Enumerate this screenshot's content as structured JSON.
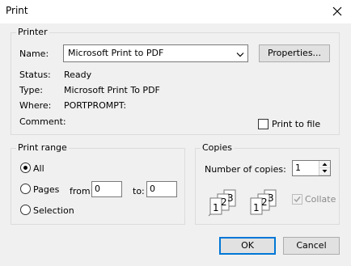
{
  "window": {
    "title": "Print"
  },
  "printer": {
    "group_label": "Printer",
    "name_label": "Name:",
    "name_value": "Microsoft Print to PDF",
    "properties_button": "Properties...",
    "status_label": "Status:",
    "status_value": "Ready",
    "type_label": "Type:",
    "type_value": "Microsoft Print To PDF",
    "where_label": "Where:",
    "where_value": "PORTPROMPT:",
    "comment_label": "Comment:",
    "print_to_file_label": "Print to file",
    "print_to_file_checked": false
  },
  "print_range": {
    "group_label": "Print range",
    "all_label": "All",
    "pages_label": "Pages",
    "from_label": "from:",
    "from_value": "0",
    "to_label": "to:",
    "to_value": "0",
    "selection_label": "Selection",
    "selected": "All"
  },
  "copies": {
    "group_label": "Copies",
    "number_label": "Number of copies:",
    "number_value": "1",
    "collate_label": "Collate",
    "collate_checked": true,
    "collate_disabled": true,
    "page_numbers": [
      "1",
      "2",
      "3"
    ]
  },
  "footer": {
    "ok_label": "OK",
    "cancel_label": "Cancel"
  },
  "colors": {
    "accent": "#0078d7",
    "background": "#f0f0f0"
  }
}
